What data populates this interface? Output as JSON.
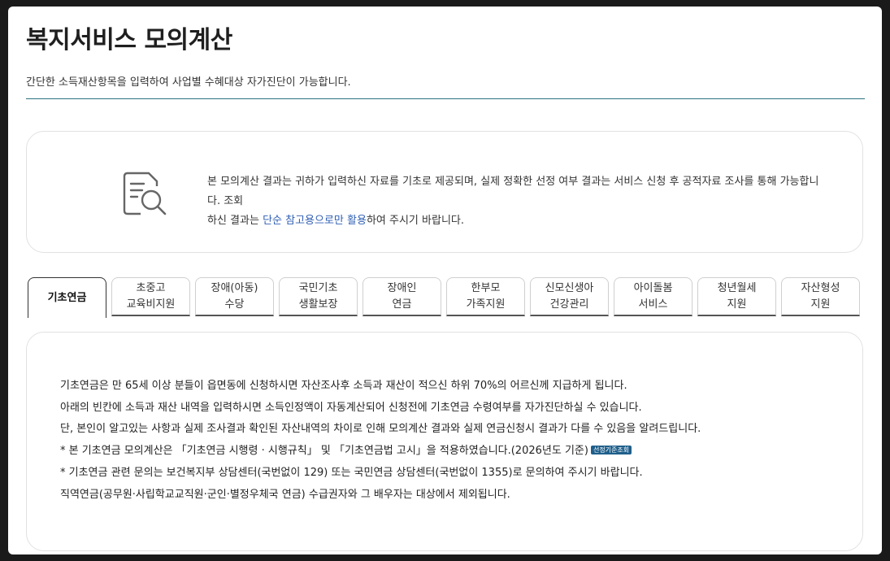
{
  "page": {
    "title": "복지서비스 모의계산",
    "subtitle": "간단한 소득재산항목을 입력하여 사업별 수혜대상 자가진단이 가능합니다."
  },
  "notice": {
    "icon": "document-search-icon",
    "text_line1": "본 모의계산 결과는 귀하가 입력하신 자료를 기초로 제공되며, 실제 정확한 선정 여부 결과는 서비스 신청 후 공적자료 조사를 통해 가능합니다. 조회",
    "text_line2_prefix": "하신 결과는 ",
    "text_line2_link": "단순 참고용으로만 활용",
    "text_line2_suffix": "하여 주시기 바랍니다."
  },
  "tabs": [
    {
      "line1": "기초연금",
      "line2": "",
      "active": true
    },
    {
      "line1": "초중고",
      "line2": "교육비지원"
    },
    {
      "line1": "장애(아동)",
      "line2": "수당"
    },
    {
      "line1": "국민기초",
      "line2": "생활보장"
    },
    {
      "line1": "장애인",
      "line2": "연금"
    },
    {
      "line1": "한부모",
      "line2": "가족지원"
    },
    {
      "line1": "신모신생아",
      "line2": "건강관리"
    },
    {
      "line1": "아이돌봄",
      "line2": "서비스"
    },
    {
      "line1": "청년월세",
      "line2": "지원"
    },
    {
      "line1": "자산형성",
      "line2": "지원"
    }
  ],
  "content": {
    "line1": "기초연금은 만 65세 이상 분들이 읍면동에 신청하시면 자산조사후 소득과 재산이 적으신 하위 70%의 어르신께 지급하게 됩니다.",
    "line2": "아래의 빈칸에 소득과 재산 내역을 입력하시면 소득인정액이 자동계산되어 신청전에 기초연금 수령여부를 자가진단하실 수 있습니다.",
    "line3": "단, 본인이 알고있는 사항과 실제 조사결과 확인된 자산내역의 차이로 인해 모의계산 결과와 실제 연금신청시 결과가 다를 수 있음을 알려드립니다.",
    "line4": "* 본 기초연금 모의계산은 「기초연금 시행령 · 시행규칙」 및 「기초연금법 고시」을 적용하였습니다.(2026년도 기준)",
    "badge": "선정기준조회",
    "line5": "* 기초연금 관련 문의는 보건복지부 상담센터(국번없이 129) 또는 국민연금 상담센터(국번없이 1355)로 문의하여 주시기 바랍니다.",
    "line6": "직역연금(공무원·사립학교교직원·군인·별정우체국 연금) 수급권자와 그 배우자는 대상에서 제외됩니다."
  },
  "colors": {
    "rule": "#2c7380",
    "link": "#2f5fb3",
    "badge": "#1f5f8b"
  }
}
